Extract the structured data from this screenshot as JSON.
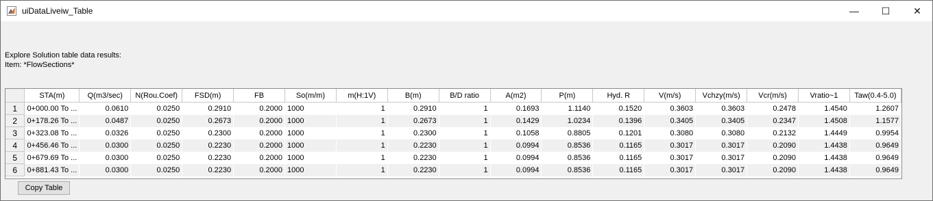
{
  "window": {
    "title": "uiDataLiveiw_Table",
    "controls": {
      "minimize": "—",
      "maximize": "☐",
      "close": "✕"
    }
  },
  "description": {
    "line1": "Explore Solution table data results:",
    "line2": "Item: *FlowSections*"
  },
  "table": {
    "columns": [
      "STA(m)",
      "Q(m3/sec)",
      "N(Rou.Coef)",
      "FSD(m)",
      "FB",
      "So(m/m)",
      "m(H:1V)",
      "B(m)",
      "B/D ratio",
      "A(m2)",
      "P(m)",
      "Hyd. R",
      "V(m/s)",
      "Vchzy(m/s)",
      "Vcr(m/s)",
      "Vratio~1",
      "Taw(0.4-5.0)"
    ],
    "rows": [
      {
        "num": "1",
        "cells": [
          "0+000.00 To ...",
          "0.0610",
          "0.0250",
          "0.2910",
          "0.2000",
          "1000",
          "1",
          "0.2910",
          "1",
          "0.1693",
          "1.1140",
          "0.1520",
          "0.3603",
          "0.3603",
          "0.2478",
          "1.4540",
          "1.2607"
        ]
      },
      {
        "num": "2",
        "cells": [
          "0+178.26 To ...",
          "0.0487",
          "0.0250",
          "0.2673",
          "0.2000",
          "1000",
          "1",
          "0.2673",
          "1",
          "0.1429",
          "1.0234",
          "0.1396",
          "0.3405",
          "0.3405",
          "0.2347",
          "1.4508",
          "1.1577"
        ]
      },
      {
        "num": "3",
        "cells": [
          "0+323.08 To ...",
          "0.0326",
          "0.0250",
          "0.2300",
          "0.2000",
          "1000",
          "1",
          "0.2300",
          "1",
          "0.1058",
          "0.8805",
          "0.1201",
          "0.3080",
          "0.3080",
          "0.2132",
          "1.4449",
          "0.9954"
        ]
      },
      {
        "num": "4",
        "cells": [
          "0+456.46 To ...",
          "0.0300",
          "0.0250",
          "0.2230",
          "0.2000",
          "1000",
          "1",
          "0.2230",
          "1",
          "0.0994",
          "0.8536",
          "0.1165",
          "0.3017",
          "0.3017",
          "0.2090",
          "1.4438",
          "0.9649"
        ]
      },
      {
        "num": "5",
        "cells": [
          "0+679.69 To ...",
          "0.0300",
          "0.0250",
          "0.2230",
          "0.2000",
          "1000",
          "1",
          "0.2230",
          "1",
          "0.0994",
          "0.8536",
          "0.1165",
          "0.3017",
          "0.3017",
          "0.2090",
          "1.4438",
          "0.9649"
        ]
      },
      {
        "num": "6",
        "cells": [
          "0+881.43 To ...",
          "0.0300",
          "0.0250",
          "0.2230",
          "0.2000",
          "1000",
          "1",
          "0.2230",
          "1",
          "0.0994",
          "0.8536",
          "0.1165",
          "0.3017",
          "0.3017",
          "0.2090",
          "1.4438",
          "0.9649"
        ]
      }
    ]
  },
  "buttons": {
    "copy_table": "Copy Table"
  }
}
